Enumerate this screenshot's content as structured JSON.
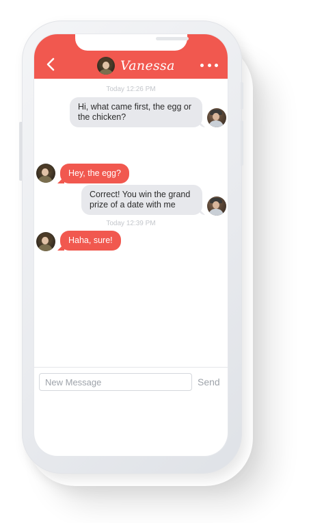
{
  "header": {
    "title": "Vanessa",
    "back_icon": "chevron-left-icon",
    "more_icon": "ellipsis-icon",
    "accent_color": "#f1584f"
  },
  "timestamps": [
    "Today 12:26 PM",
    "Today 12:39 PM"
  ],
  "messages": [
    {
      "direction": "outgoing",
      "text": "Hi, what came first, the egg or the chicken?"
    },
    {
      "direction": "incoming",
      "text": "Hey, the egg?"
    },
    {
      "direction": "outgoing",
      "text": "Correct! You win the grand prize of a date with me"
    },
    {
      "direction": "incoming",
      "text": "Haha, sure!"
    }
  ],
  "composer": {
    "placeholder": "New Message",
    "value": "",
    "send_label": "Send"
  }
}
